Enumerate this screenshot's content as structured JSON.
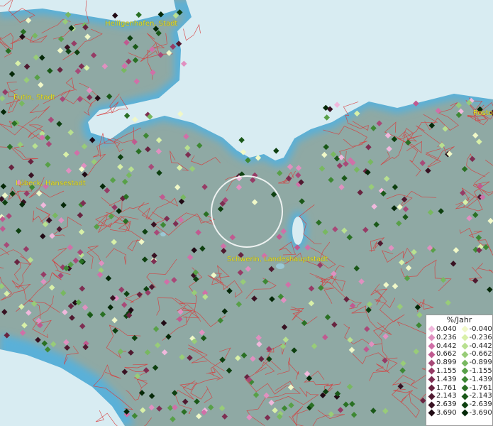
{
  "map": {
    "labels": [
      {
        "name": "heiligenhafen",
        "text": "Heiligenhafen, Stadt"
      },
      {
        "name": "eutin",
        "text": "Eutin, Stadt"
      },
      {
        "name": "rostock",
        "text": "Rosto"
      },
      {
        "name": "luebeck",
        "text": "Lübeck, Hansestadt"
      },
      {
        "name": "schwerin",
        "text": "Schwerin, Landeshauptstadt"
      }
    ],
    "colors": {
      "land": "#8fa9a4",
      "sea": "#d8ecf2",
      "coast_glow": "#5ab0d8",
      "borders": "#d83a3a",
      "selection_ring": "#ffffff"
    }
  },
  "legend": {
    "title": "%/Jahr",
    "positive": [
      {
        "label": "0.040",
        "color": "#f0b8dc"
      },
      {
        "label": "0.236",
        "color": "#e090c0"
      },
      {
        "label": "0.442",
        "color": "#d070a8"
      },
      {
        "label": "0.662",
        "color": "#c05a90"
      },
      {
        "label": "0.899",
        "color": "#a84a78"
      },
      {
        "label": "1.155",
        "color": "#963c66"
      },
      {
        "label": "1.439",
        "color": "#7e2e52"
      },
      {
        "label": "1.761",
        "color": "#682440"
      },
      {
        "label": "2.143",
        "color": "#501a30"
      },
      {
        "label": "2.639",
        "color": "#381222"
      },
      {
        "label": "3.690",
        "color": "#200a14"
      }
    ],
    "negative": [
      {
        "label": "-0.040",
        "color": "#f0f8c8"
      },
      {
        "label": "-0.236",
        "color": "#d8f0a8"
      },
      {
        "label": "-0.442",
        "color": "#b8e090"
      },
      {
        "label": "-0.662",
        "color": "#98cc78"
      },
      {
        "label": "-0.899",
        "color": "#78b860"
      },
      {
        "label": "-1.155",
        "color": "#58a048"
      },
      {
        "label": "-1.439",
        "color": "#3e8834"
      },
      {
        "label": "-1.761",
        "color": "#2a7024"
      },
      {
        "label": "-2.143",
        "color": "#1a5818"
      },
      {
        "label": "-2.639",
        "color": "#0e4010"
      },
      {
        "label": "-3.690",
        "color": "#052808"
      }
    ]
  }
}
